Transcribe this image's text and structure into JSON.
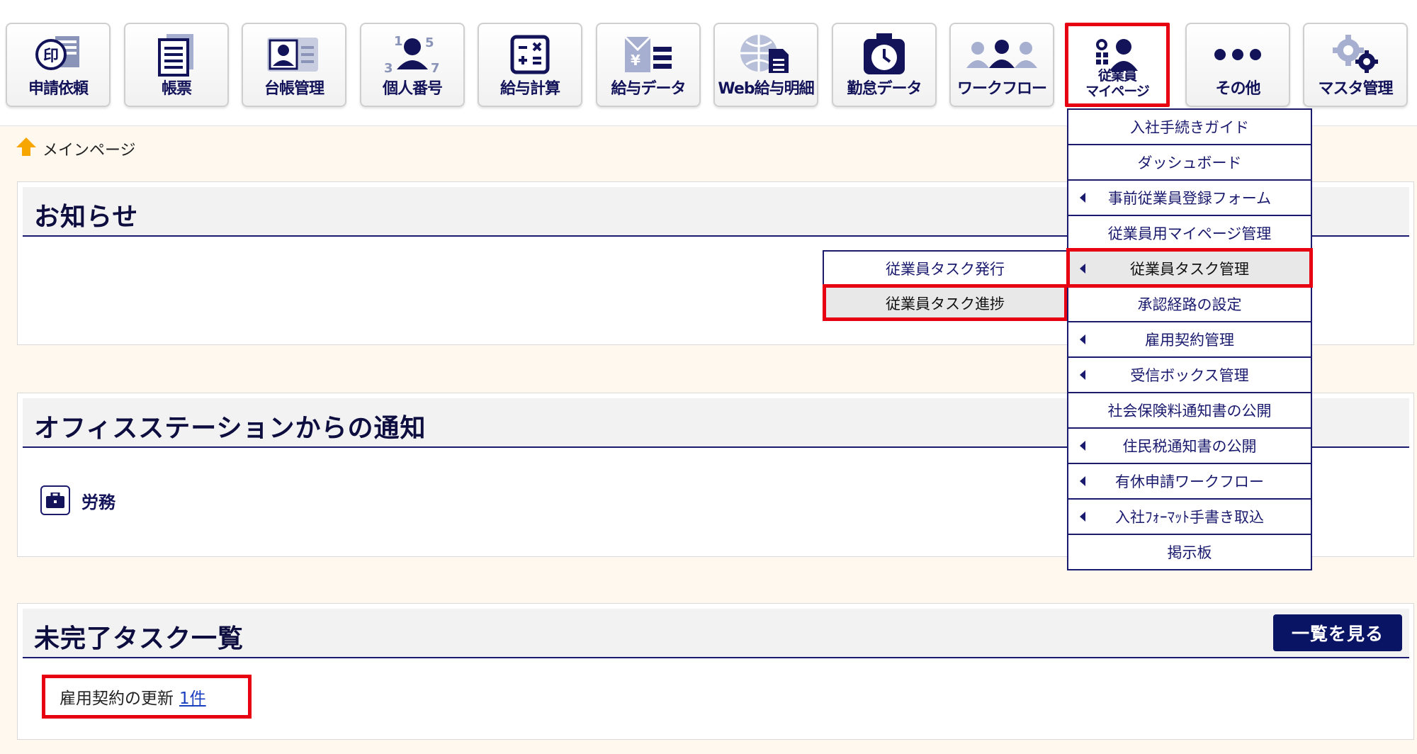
{
  "toolbar": {
    "items": [
      {
        "label": "申請依頼",
        "icon": "stamp-request-icon"
      },
      {
        "label": "帳票",
        "icon": "document-list-icon"
      },
      {
        "label": "台帳管理",
        "icon": "ledger-card-icon"
      },
      {
        "label": "個人番号",
        "icon": "personal-number-icon"
      },
      {
        "label": "給与計算",
        "icon": "calculator-icon"
      },
      {
        "label": "給与データ",
        "icon": "salary-data-icon"
      },
      {
        "label": "Web給与明細",
        "icon": "web-payslip-icon"
      },
      {
        "label": "勤怠データ",
        "icon": "clock-icon"
      },
      {
        "label": "ワークフロー",
        "icon": "workflow-people-icon"
      },
      {
        "label_line1": "従業員",
        "label_line2": "マイページ",
        "icon": "employee-mypage-icon",
        "selected": true
      },
      {
        "label": "その他",
        "icon": "more-dots-icon"
      },
      {
        "label": "マスタ管理",
        "icon": "gears-icon"
      }
    ]
  },
  "breadcrumb": {
    "label": "メインページ",
    "icon": "home-icon"
  },
  "panels": {
    "notice": {
      "title": "お知らせ"
    },
    "office_station": {
      "title": "オフィスステーションからの通知",
      "labor_label": "労務"
    },
    "pending_tasks": {
      "title": "未完了タスク一覧",
      "view_all": "一覧を見る",
      "task_label": "雇用契約の更新",
      "task_count": "1件"
    }
  },
  "dropdown": {
    "items": [
      {
        "label": "入社手続きガイド",
        "has_submenu": false
      },
      {
        "label": "ダッシュボード",
        "has_submenu": false
      },
      {
        "label": "事前従業員登録フォーム",
        "has_submenu": true
      },
      {
        "label": "従業員用マイページ管理",
        "has_submenu": false
      },
      {
        "label": "従業員タスク管理",
        "has_submenu": true,
        "highlighted": true
      },
      {
        "label": "承認経路の設定",
        "has_submenu": false
      },
      {
        "label": "雇用契約管理",
        "has_submenu": true
      },
      {
        "label": "受信ボックス管理",
        "has_submenu": true
      },
      {
        "label": "社会保険料通知書の公開",
        "has_submenu": false
      },
      {
        "label": "住民税通知書の公開",
        "has_submenu": true
      },
      {
        "label": "有休申請ワークフロー",
        "has_submenu": true
      },
      {
        "label": "入社ﾌｫｰﾏｯﾄ手書き取込",
        "has_submenu": true
      },
      {
        "label": "掲示板",
        "has_submenu": false
      }
    ]
  },
  "submenu": {
    "items": [
      {
        "label": "従業員タスク発行"
      },
      {
        "label": "従業員タスク進捗",
        "highlighted": true
      }
    ]
  },
  "colors": {
    "navy": "#13135a",
    "highlight_red": "#e60012",
    "page_bg": "#fff8ef",
    "button_navy": "#0a1464"
  }
}
